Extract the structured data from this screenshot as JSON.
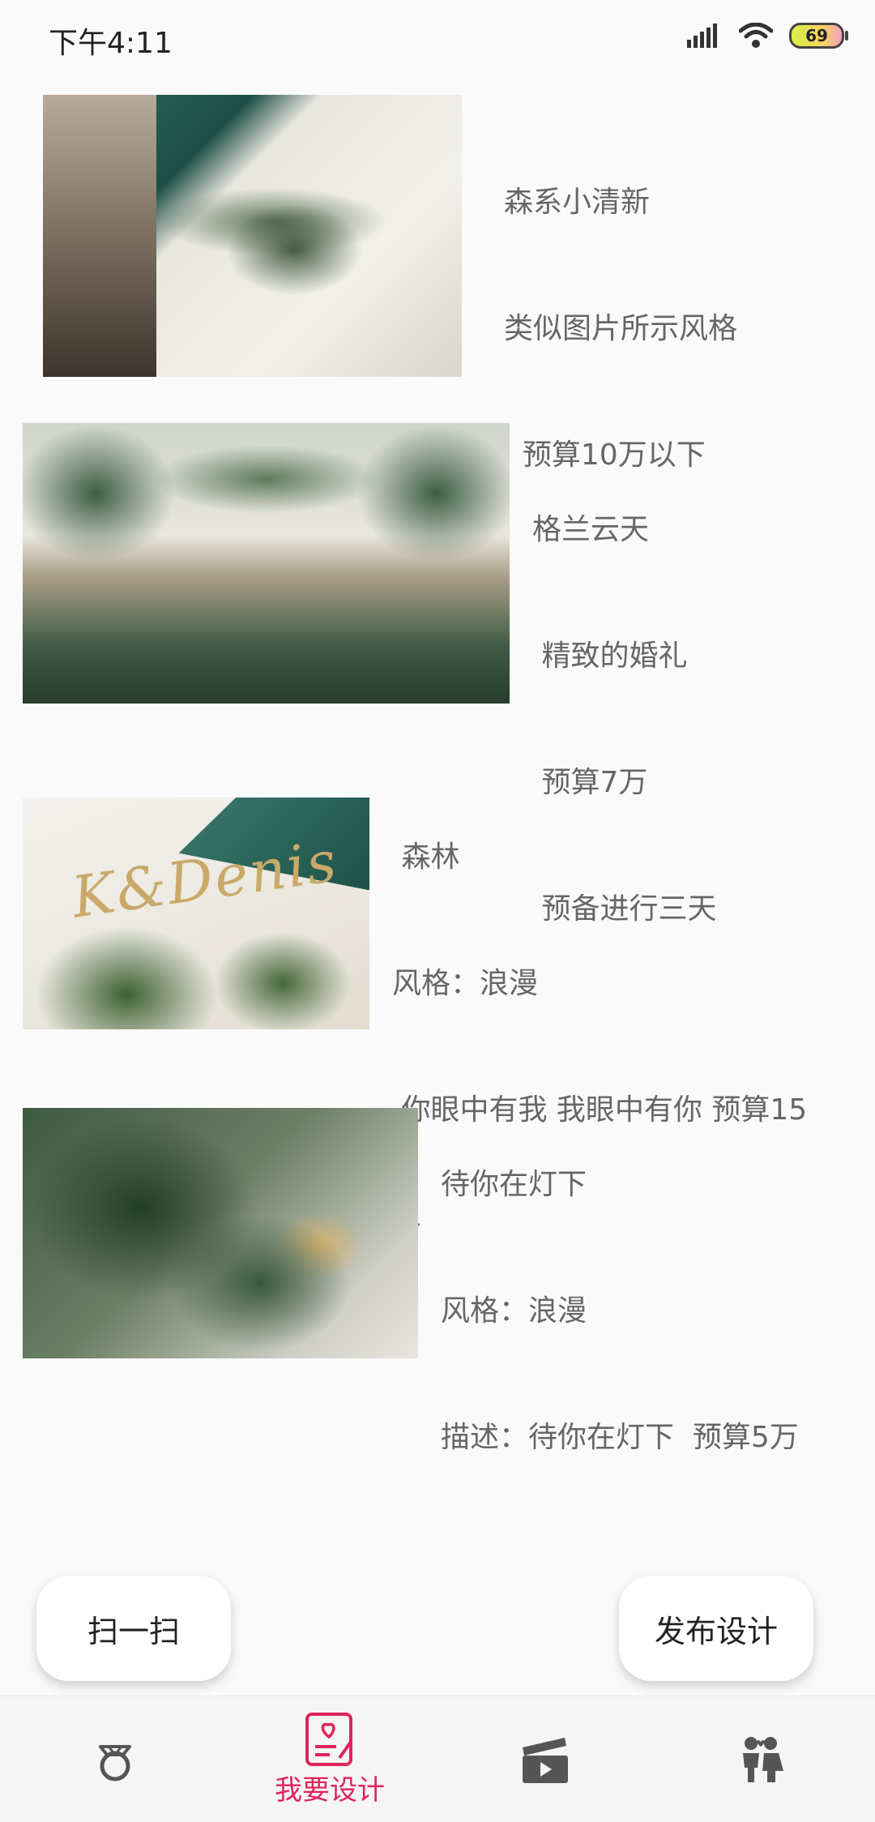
{
  "status_bar": {
    "time": "下午4:11",
    "battery": "69"
  },
  "designs": [
    {
      "lines": [
        "森系小清新",
        "类似图片所示风格",
        "  预算10万以下"
      ]
    },
    {
      "lines": [
        "格兰云天",
        " 精致的婚礼",
        " 预算7万",
        " 预备进行三天"
      ]
    },
    {
      "lines": [
        " 森林",
        "风格：浪漫",
        " 你眼中有我 我眼中有你 预算15",
        "万"
      ]
    },
    {
      "lines": [
        "待你在灯下",
        "风格：浪漫",
        "描述：待你在灯下  预算5万"
      ]
    }
  ],
  "buttons": {
    "scan": "扫一扫",
    "publish": "发布设计"
  },
  "tabbar": {
    "active_label": "我要设计",
    "accent_color": "#e0245e",
    "icons": [
      "ring-icon",
      "design-icon",
      "video-icon",
      "couple-icon"
    ]
  }
}
